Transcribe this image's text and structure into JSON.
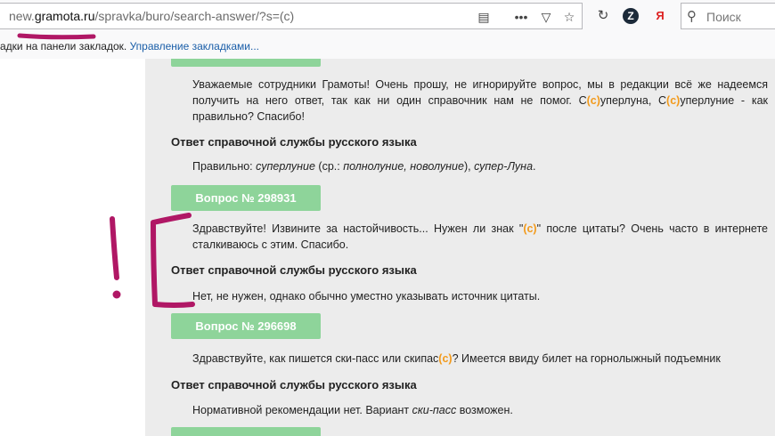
{
  "browser": {
    "url_prefix": "new.",
    "url_domain": "gramota.ru",
    "url_path": "/spravka/buro/search-answer/?s=(c)",
    "search_placeholder": "Поиск",
    "yandex_label": "Я",
    "zen_label": "Z"
  },
  "bookmarks_bar": {
    "text": "адки на панели закладок.",
    "link": "Управление закладками..."
  },
  "entries": [
    {
      "question_parts": [
        "Уважаемые сотрудники Грамоты! Очень прошу, не игнорируйте вопрос, мы в редакции всё же надеемся получить на него ответ, так как ни один справочник нам не помог. С",
        "(с)",
        "уперлуна, С",
        "(с)",
        "уперлуние - как правильно? Спасибо!"
      ],
      "answer_heading": "Ответ справочной службы русского языка",
      "answer_parts": [
        "Правильно: ",
        "суперлуние",
        " (ср.: ",
        "полнолуние, новолуние",
        "), ",
        "супер-Луна",
        "."
      ]
    },
    {
      "button": "Вопрос № 298931",
      "question_parts": [
        "Здравствуйте! Извините за настойчивость... Нужен ли знак \"",
        "(с)",
        "\" после цитаты? Очень часто в интернете сталкиваюсь с этим. Спасибо."
      ],
      "answer_heading": "Ответ справочной службы русского языка",
      "answer": "Нет, не нужен, однако обычно уместно указывать источник цитаты."
    },
    {
      "button": "Вопрос № 296698",
      "question_parts": [
        "Здравствуйте, как пишется ски-пасс или скипас",
        "(с)",
        "? Имеется ввиду билет на горнолыжный подъемник"
      ],
      "answer_heading": "Ответ справочной службы русского языка",
      "answer_parts": [
        "Нормативной рекомендации нет. Вариант ",
        "ски-пасс",
        " возможен."
      ]
    }
  ],
  "colors": {
    "question_button": "#8ed49a",
    "copyright_mark": "#f29a1b",
    "annotation": "#b01765",
    "content_bg": "#ececec"
  }
}
